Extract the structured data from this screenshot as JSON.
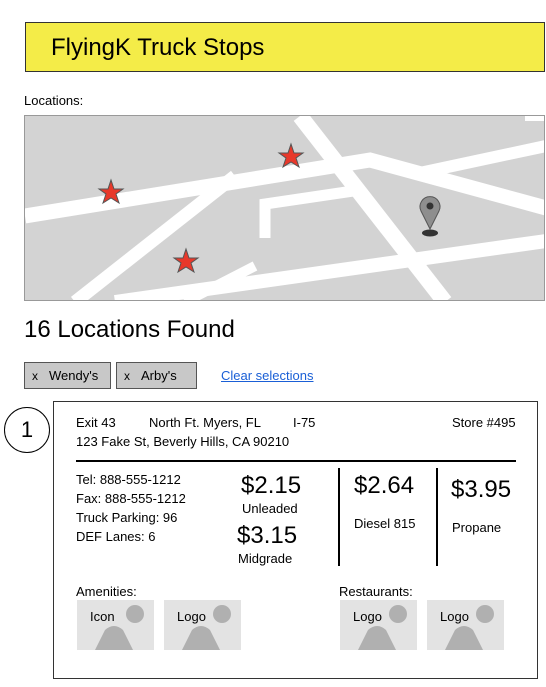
{
  "header": {
    "title": "FlyingK Truck Stops",
    "bg_color": "#f4ec48"
  },
  "locations_label": "Locations:",
  "results": {
    "title": "16 Locations Found"
  },
  "filters": {
    "chips": [
      {
        "remove": "x",
        "label": "Wendy's"
      },
      {
        "remove": "x",
        "label": "Arby's"
      }
    ],
    "clear_label": "Clear selections"
  },
  "result_card": {
    "number": "1",
    "exit": "Exit 43",
    "city": "North Ft. Myers, FL",
    "highway": "I-75",
    "store": "Store #495",
    "address": "123 Fake St, Beverly Hills, CA 90210",
    "tel": "Tel: 888-555-1212",
    "fax": "Fax: 888-555-1212",
    "truck_parking": "Truck Parking: 96",
    "def_lanes": "DEF Lanes: 6",
    "prices": {
      "unleaded": {
        "price": "$2.15",
        "label": "Unleaded"
      },
      "midgrade": {
        "price": "$3.15",
        "label": "Midgrade"
      },
      "diesel": {
        "price": "$2.64",
        "label": "Diesel 815"
      },
      "propane": {
        "price": "$3.95",
        "label": "Propane"
      }
    },
    "amenities": {
      "label": "Amenities:",
      "items": [
        {
          "label": "Icon"
        },
        {
          "label": "Logo"
        }
      ]
    },
    "restaurants": {
      "label": "Restaurants:",
      "items": [
        {
          "label": "Logo"
        },
        {
          "label": "Logo"
        }
      ]
    }
  },
  "map": {
    "marker_color": "#e8382a",
    "pin_color": "#8e8e8e",
    "markers": [
      "star-marker",
      "star-marker",
      "star-marker"
    ],
    "pin": "map-pin-icon"
  }
}
